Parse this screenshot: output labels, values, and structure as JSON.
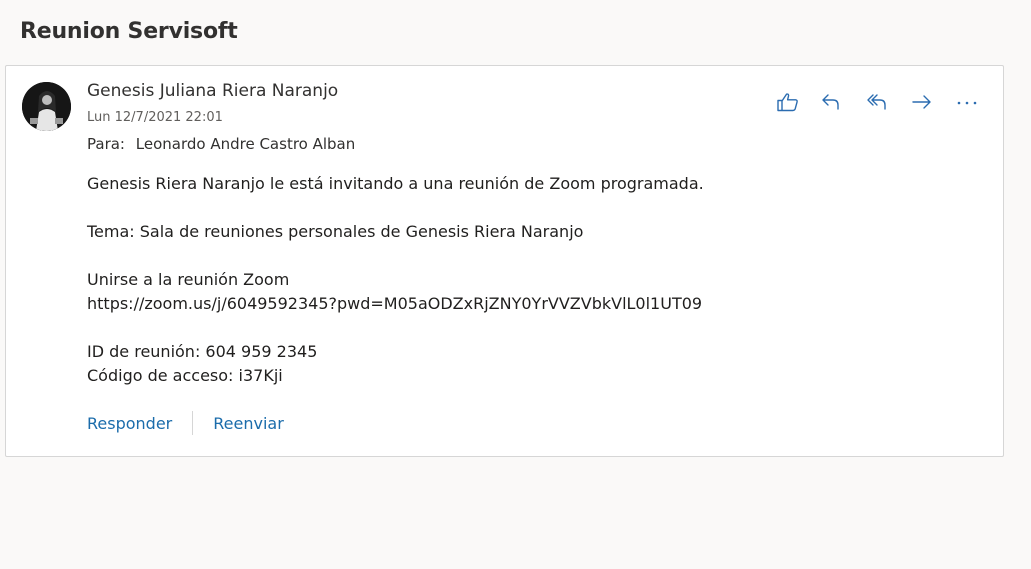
{
  "subject": "Reunion Servisoft",
  "message": {
    "sender": "Genesis Juliana Riera Naranjo",
    "date": "Lun 12/7/2021 22:01",
    "to_label": "Para:",
    "to": "Leonardo Andre Castro Alban",
    "body": {
      "intro": "Genesis Riera Naranjo le está invitando a una reunión de Zoom programada.",
      "topic": "Tema: Sala de reuniones personales de Genesis Riera Naranjo",
      "join_label": "Unirse a la reunión Zoom",
      "join_url": "https://zoom.us/j/6049592345?pwd=M05aODZxRjZNY0YrVVZVbkVlL0l1UT09",
      "meeting_id": "ID de reunión: 604 959 2345",
      "passcode": "Código de acceso: i37Kji"
    }
  },
  "actions": {
    "icons": [
      "like-icon",
      "reply-icon",
      "reply-all-icon",
      "forward-icon",
      "more-icon"
    ],
    "accent": "#2b6cb0"
  },
  "reply_bar": {
    "reply": "Responder",
    "forward": "Reenviar"
  }
}
